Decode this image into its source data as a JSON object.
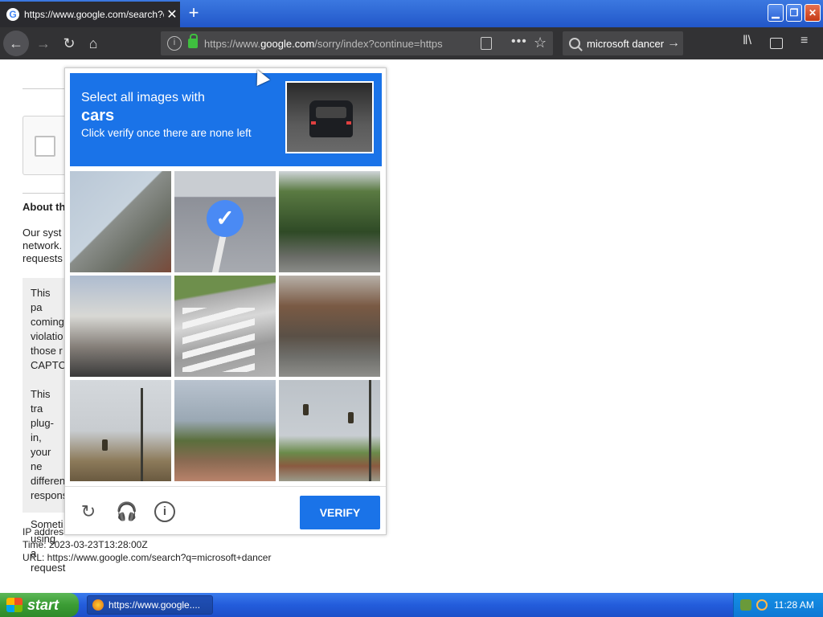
{
  "browser": {
    "tab_title": "https://www.google.com/search?q",
    "tab_close": "✕",
    "new_tab": "+",
    "url_prefix": "https://www.",
    "url_domain": "google.com",
    "url_suffix": "/sorry/index?continue=https",
    "search_text": "microsoft dancer",
    "window_buttons": {
      "minimize": "▁",
      "maximize": "❐",
      "close": "✕"
    }
  },
  "page": {
    "about_heading": "About th",
    "about_text": "Our syst network. requests",
    "info_box": [
      "This pa coming violatio those r CAPTC",
      "This tra plug-in, your ne differen respons",
      "Someti using a request"
    ],
    "ip_label": "IP addres",
    "time": "Time: 2023-03-23T13:28:00Z",
    "url": "URL: https://www.google.com/search?q=microsoft+dancer"
  },
  "captcha": {
    "line1": "Select all images with",
    "object": "cars",
    "line2": "Click verify once there are none left",
    "tiles": [
      {
        "id": 0,
        "selected": false
      },
      {
        "id": 1,
        "selected": true
      },
      {
        "id": 2,
        "selected": false
      },
      {
        "id": 3,
        "selected": false
      },
      {
        "id": 4,
        "selected": false
      },
      {
        "id": 5,
        "selected": false
      },
      {
        "id": 6,
        "selected": false
      },
      {
        "id": 7,
        "selected": false
      },
      {
        "id": 8,
        "selected": false
      }
    ],
    "verify_label": "VERIFY",
    "check_mark": "✓"
  },
  "taskbar": {
    "start_label": "start",
    "task_label": "https://www.google....",
    "clock": "11:28 AM"
  }
}
